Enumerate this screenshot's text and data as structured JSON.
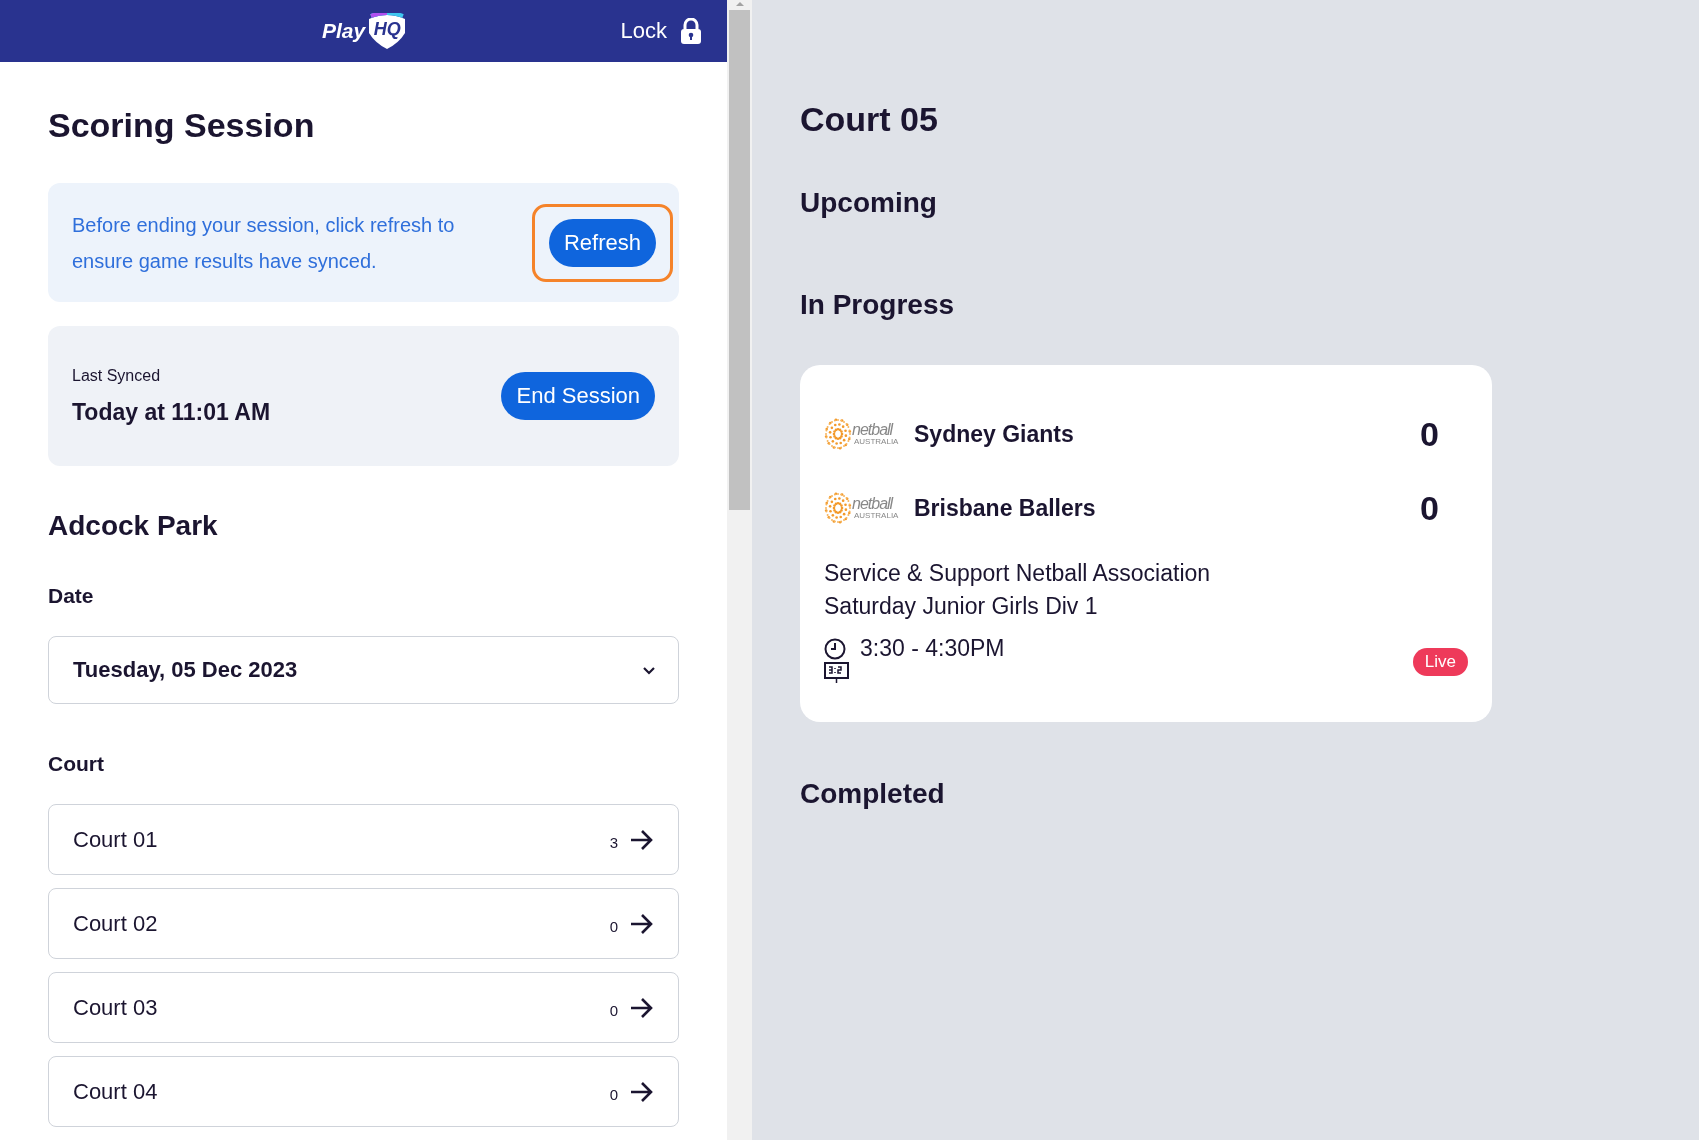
{
  "header": {
    "logo": {
      "text_1": "Play",
      "text_2": "HQ"
    },
    "lock_label": "Lock"
  },
  "session": {
    "title": "Scoring Session",
    "notice": {
      "text": "Before ending your session, click refresh to ensure game results have synced.",
      "button": {
        "label": "Refresh",
        "highlighted": true
      }
    },
    "sync": {
      "label": "Last Synced",
      "time": "Today at 11:01 AM",
      "button": "End Session"
    },
    "venue": "Adcock Park",
    "date": {
      "label": "Date",
      "value": "Tuesday, 05 Dec 2023"
    },
    "court": {
      "label": "Court",
      "items": [
        {
          "name": "Court 01",
          "count": "3"
        },
        {
          "name": "Court 02",
          "count": "0"
        },
        {
          "name": "Court 03",
          "count": "0"
        },
        {
          "name": "Court 04",
          "count": "0"
        }
      ]
    }
  },
  "court_view": {
    "title": "Court 05",
    "sections": [
      {
        "title": "Upcoming"
      },
      {
        "title": "In Progress",
        "games": [
          {
            "teams": [
              {
                "name": "Sydney Giants",
                "score": "0",
                "logo_text": "netball",
                "logo_subtext": "AUSTRALIA"
              },
              {
                "name": "Brisbane Ballers",
                "score": "0",
                "logo_text": "netball",
                "logo_subtext": "AUSTRALIA"
              }
            ],
            "competition": [
              "Service & Support Netball Association",
              "Saturday Junior Girls Div 1"
            ],
            "time": "3:30 - 4:30PM",
            "status": {
              "kind": "live",
              "label": "Live"
            }
          }
        ]
      },
      {
        "title": "Completed"
      }
    ]
  }
}
